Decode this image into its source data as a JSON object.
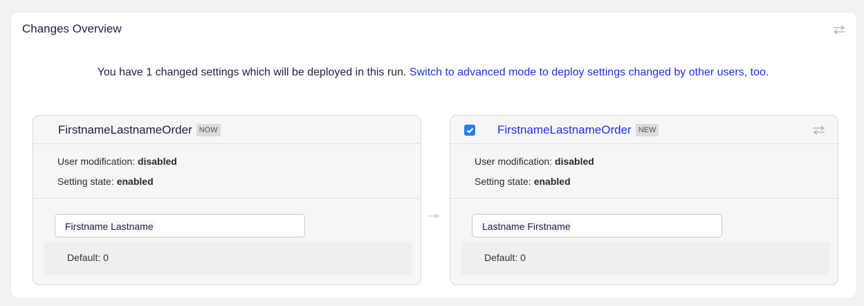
{
  "panel": {
    "title": "Changes Overview",
    "toggle_icon": "swap-arrows-icon"
  },
  "intro": {
    "text": "You have 1 changed settings which will be deployed in this run.",
    "link": "Switch to advanced mode to deploy settings changed by other users, too."
  },
  "current": {
    "name": "FirstnameLastnameOrder",
    "tag": "NOW",
    "user_mod_label": "User modification:",
    "user_mod_value": "disabled",
    "state_label": "Setting state:",
    "state_value": "enabled",
    "field_value": "Firstname Lastname",
    "default": "Default: 0"
  },
  "new": {
    "checked": true,
    "name": "FirstnameLastnameOrder",
    "tag": "NEW",
    "user_mod_label": "User modification:",
    "user_mod_value": "disabled",
    "state_label": "Setting state:",
    "state_value": "enabled",
    "field_value": "Lastname Firstname",
    "default": "Default: 0",
    "toggle_icon": "swap-arrows-icon"
  },
  "colors": {
    "link": "#1f2ef5",
    "checkbox": "#2d7de8"
  }
}
